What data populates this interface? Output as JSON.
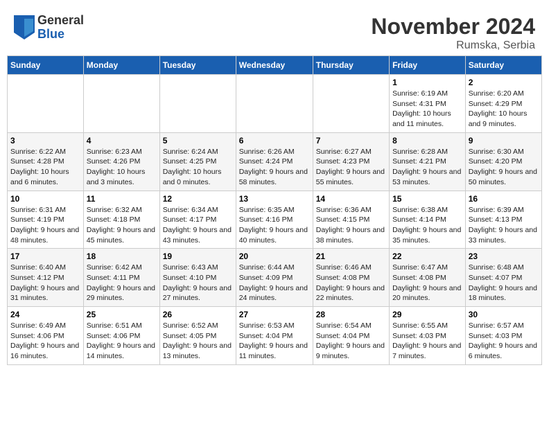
{
  "logo": {
    "general": "General",
    "blue": "Blue"
  },
  "header": {
    "title": "November 2024",
    "location": "Rumska, Serbia"
  },
  "days_of_week": [
    "Sunday",
    "Monday",
    "Tuesday",
    "Wednesday",
    "Thursday",
    "Friday",
    "Saturday"
  ],
  "weeks": [
    [
      {
        "day": "",
        "info": ""
      },
      {
        "day": "",
        "info": ""
      },
      {
        "day": "",
        "info": ""
      },
      {
        "day": "",
        "info": ""
      },
      {
        "day": "",
        "info": ""
      },
      {
        "day": "1",
        "info": "Sunrise: 6:19 AM\nSunset: 4:31 PM\nDaylight: 10 hours and 11 minutes."
      },
      {
        "day": "2",
        "info": "Sunrise: 6:20 AM\nSunset: 4:29 PM\nDaylight: 10 hours and 9 minutes."
      }
    ],
    [
      {
        "day": "3",
        "info": "Sunrise: 6:22 AM\nSunset: 4:28 PM\nDaylight: 10 hours and 6 minutes."
      },
      {
        "day": "4",
        "info": "Sunrise: 6:23 AM\nSunset: 4:26 PM\nDaylight: 10 hours and 3 minutes."
      },
      {
        "day": "5",
        "info": "Sunrise: 6:24 AM\nSunset: 4:25 PM\nDaylight: 10 hours and 0 minutes."
      },
      {
        "day": "6",
        "info": "Sunrise: 6:26 AM\nSunset: 4:24 PM\nDaylight: 9 hours and 58 minutes."
      },
      {
        "day": "7",
        "info": "Sunrise: 6:27 AM\nSunset: 4:23 PM\nDaylight: 9 hours and 55 minutes."
      },
      {
        "day": "8",
        "info": "Sunrise: 6:28 AM\nSunset: 4:21 PM\nDaylight: 9 hours and 53 minutes."
      },
      {
        "day": "9",
        "info": "Sunrise: 6:30 AM\nSunset: 4:20 PM\nDaylight: 9 hours and 50 minutes."
      }
    ],
    [
      {
        "day": "10",
        "info": "Sunrise: 6:31 AM\nSunset: 4:19 PM\nDaylight: 9 hours and 48 minutes."
      },
      {
        "day": "11",
        "info": "Sunrise: 6:32 AM\nSunset: 4:18 PM\nDaylight: 9 hours and 45 minutes."
      },
      {
        "day": "12",
        "info": "Sunrise: 6:34 AM\nSunset: 4:17 PM\nDaylight: 9 hours and 43 minutes."
      },
      {
        "day": "13",
        "info": "Sunrise: 6:35 AM\nSunset: 4:16 PM\nDaylight: 9 hours and 40 minutes."
      },
      {
        "day": "14",
        "info": "Sunrise: 6:36 AM\nSunset: 4:15 PM\nDaylight: 9 hours and 38 minutes."
      },
      {
        "day": "15",
        "info": "Sunrise: 6:38 AM\nSunset: 4:14 PM\nDaylight: 9 hours and 35 minutes."
      },
      {
        "day": "16",
        "info": "Sunrise: 6:39 AM\nSunset: 4:13 PM\nDaylight: 9 hours and 33 minutes."
      }
    ],
    [
      {
        "day": "17",
        "info": "Sunrise: 6:40 AM\nSunset: 4:12 PM\nDaylight: 9 hours and 31 minutes."
      },
      {
        "day": "18",
        "info": "Sunrise: 6:42 AM\nSunset: 4:11 PM\nDaylight: 9 hours and 29 minutes."
      },
      {
        "day": "19",
        "info": "Sunrise: 6:43 AM\nSunset: 4:10 PM\nDaylight: 9 hours and 27 minutes."
      },
      {
        "day": "20",
        "info": "Sunrise: 6:44 AM\nSunset: 4:09 PM\nDaylight: 9 hours and 24 minutes."
      },
      {
        "day": "21",
        "info": "Sunrise: 6:46 AM\nSunset: 4:08 PM\nDaylight: 9 hours and 22 minutes."
      },
      {
        "day": "22",
        "info": "Sunrise: 6:47 AM\nSunset: 4:08 PM\nDaylight: 9 hours and 20 minutes."
      },
      {
        "day": "23",
        "info": "Sunrise: 6:48 AM\nSunset: 4:07 PM\nDaylight: 9 hours and 18 minutes."
      }
    ],
    [
      {
        "day": "24",
        "info": "Sunrise: 6:49 AM\nSunset: 4:06 PM\nDaylight: 9 hours and 16 minutes."
      },
      {
        "day": "25",
        "info": "Sunrise: 6:51 AM\nSunset: 4:06 PM\nDaylight: 9 hours and 14 minutes."
      },
      {
        "day": "26",
        "info": "Sunrise: 6:52 AM\nSunset: 4:05 PM\nDaylight: 9 hours and 13 minutes."
      },
      {
        "day": "27",
        "info": "Sunrise: 6:53 AM\nSunset: 4:04 PM\nDaylight: 9 hours and 11 minutes."
      },
      {
        "day": "28",
        "info": "Sunrise: 6:54 AM\nSunset: 4:04 PM\nDaylight: 9 hours and 9 minutes."
      },
      {
        "day": "29",
        "info": "Sunrise: 6:55 AM\nSunset: 4:03 PM\nDaylight: 9 hours and 7 minutes."
      },
      {
        "day": "30",
        "info": "Sunrise: 6:57 AM\nSunset: 4:03 PM\nDaylight: 9 hours and 6 minutes."
      }
    ]
  ]
}
